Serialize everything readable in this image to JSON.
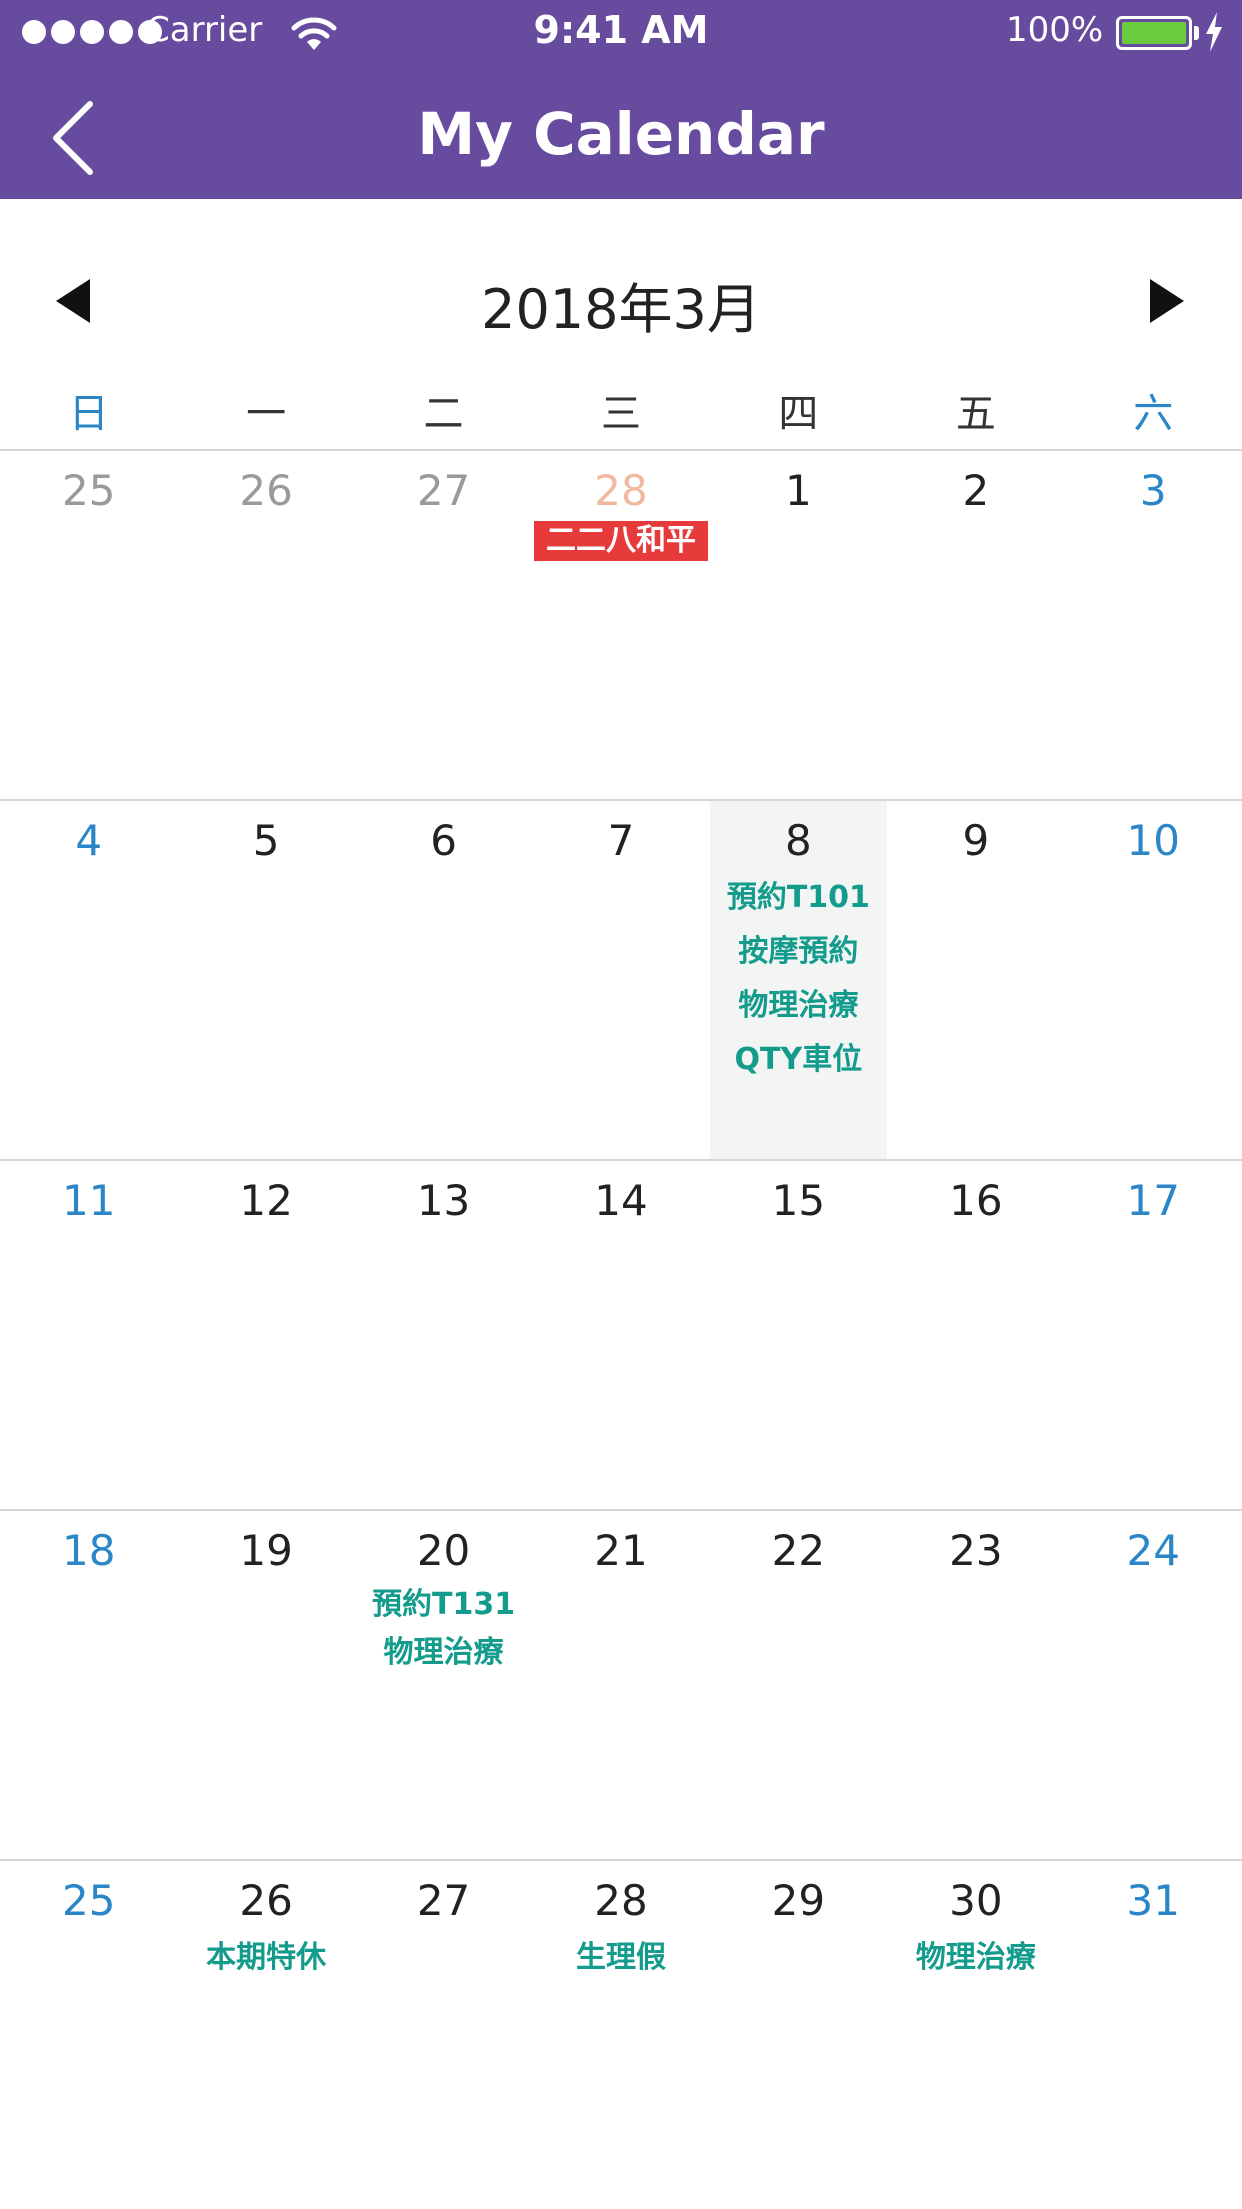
{
  "status_bar": {
    "carrier": "Carrier",
    "time": "9:41 AM",
    "battery": "100%"
  },
  "header": {
    "title": "My Calendar"
  },
  "calendar": {
    "month_label": "2018年3月",
    "weekdays": [
      "日",
      "一",
      "二",
      "三",
      "四",
      "五",
      "六"
    ],
    "weeks": [
      [
        {
          "day": "25",
          "type": "other",
          "events": []
        },
        {
          "day": "26",
          "type": "other",
          "events": []
        },
        {
          "day": "27",
          "type": "other",
          "events": []
        },
        {
          "day": "28",
          "type": "holiday-prev",
          "holiday": "二二八和平",
          "events": []
        },
        {
          "day": "1",
          "type": "normal",
          "events": []
        },
        {
          "day": "2",
          "type": "normal",
          "events": []
        },
        {
          "day": "3",
          "type": "weekend",
          "events": []
        }
      ],
      [
        {
          "day": "4",
          "type": "weekend",
          "events": []
        },
        {
          "day": "5",
          "type": "normal",
          "events": []
        },
        {
          "day": "6",
          "type": "normal",
          "events": []
        },
        {
          "day": "7",
          "type": "normal",
          "events": []
        },
        {
          "day": "8",
          "type": "normal",
          "today": true,
          "events": [
            "預約T101",
            "按摩預約",
            "物理治療",
            "QTY車位"
          ]
        },
        {
          "day": "9",
          "type": "normal",
          "events": []
        },
        {
          "day": "10",
          "type": "weekend",
          "events": []
        }
      ],
      [
        {
          "day": "11",
          "type": "weekend",
          "events": []
        },
        {
          "day": "12",
          "type": "normal",
          "events": []
        },
        {
          "day": "13",
          "type": "normal",
          "events": []
        },
        {
          "day": "14",
          "type": "normal",
          "events": []
        },
        {
          "day": "15",
          "type": "normal",
          "events": []
        },
        {
          "day": "16",
          "type": "normal",
          "events": []
        },
        {
          "day": "17",
          "type": "weekend",
          "events": []
        }
      ],
      [
        {
          "day": "18",
          "type": "weekend",
          "events": []
        },
        {
          "day": "19",
          "type": "normal",
          "events": []
        },
        {
          "day": "20",
          "type": "normal",
          "compact": true,
          "events": [
            "預約T131",
            "物理治療"
          ]
        },
        {
          "day": "21",
          "type": "normal",
          "events": []
        },
        {
          "day": "22",
          "type": "normal",
          "events": []
        },
        {
          "day": "23",
          "type": "normal",
          "events": []
        },
        {
          "day": "24",
          "type": "weekend",
          "events": []
        }
      ],
      [
        {
          "day": "25",
          "type": "weekend",
          "events": []
        },
        {
          "day": "26",
          "type": "normal",
          "events": [
            "本期特休"
          ]
        },
        {
          "day": "27",
          "type": "normal",
          "events": []
        },
        {
          "day": "28",
          "type": "normal",
          "events": [
            "生理假"
          ]
        },
        {
          "day": "29",
          "type": "normal",
          "events": []
        },
        {
          "day": "30",
          "type": "normal",
          "events": [
            "物理治療"
          ]
        },
        {
          "day": "31",
          "type": "weekend",
          "events": []
        }
      ]
    ]
  },
  "colors": {
    "header": "#674b9e",
    "weekend": "#2a86c7",
    "event": "#139b8c",
    "holiday": "#e73a3a",
    "battery": "#6acb3c"
  }
}
